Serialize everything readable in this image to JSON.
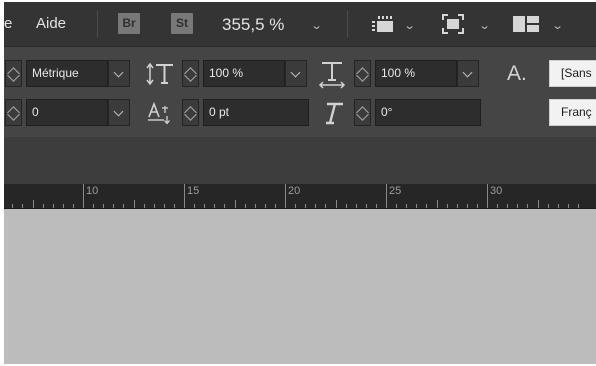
{
  "menubar": {
    "menu_fragment": "e",
    "help_label": "Aide",
    "bridge_label": "Br",
    "stock_label": "St",
    "zoom": "355,5 %"
  },
  "control_panel": {
    "kerning_method": "Métrique",
    "tracking": "0",
    "vertical_scale": "100 %",
    "baseline_shift": "0 pt",
    "horizontal_scale": "100 %",
    "skew": "0°",
    "char_style_glyph": "A.",
    "font_family": "[Sans",
    "language": "Franç"
  },
  "ruler": {
    "labels": [
      "10",
      "15",
      "20",
      "25",
      "30"
    ]
  }
}
